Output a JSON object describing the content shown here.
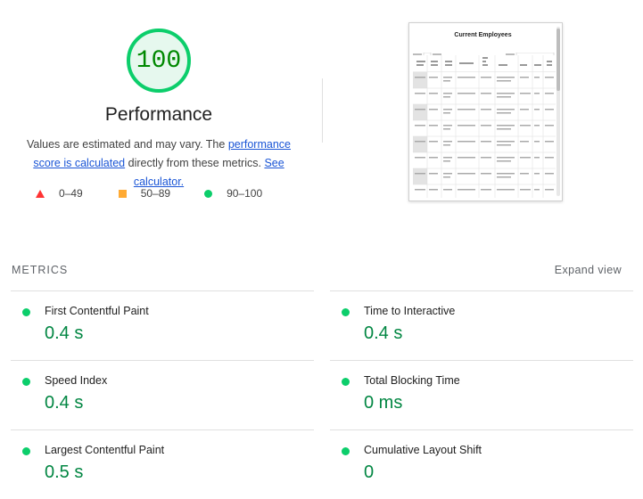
{
  "score": "100",
  "category_title": "Performance",
  "description": {
    "prefix": "Values are estimated and may vary. The ",
    "link1": "performance score is calculated",
    "middle": " directly from these metrics. ",
    "link2": "See calculator."
  },
  "legend": [
    {
      "range": "0–49",
      "color": "#ff3333"
    },
    {
      "range": "50–89",
      "color": "#ffaa33"
    },
    {
      "range": "90–100",
      "color": "#0cce6b"
    }
  ],
  "thumbnail": {
    "title": "Current Employees"
  },
  "metrics_header": "METRICS",
  "expand_view": "Expand view",
  "metrics": [
    {
      "name": "First Contentful Paint",
      "value": "0.4 s"
    },
    {
      "name": "Time to Interactive",
      "value": "0.4 s"
    },
    {
      "name": "Speed Index",
      "value": "0.4 s"
    },
    {
      "name": "Total Blocking Time",
      "value": "0 ms"
    },
    {
      "name": "Largest Contentful Paint",
      "value": "0.5 s"
    },
    {
      "name": "Cumulative Layout Shift",
      "value": "0"
    }
  ],
  "colors": {
    "pass": "#0cce6b",
    "pass_text": "#018642",
    "link": "#1a55d6"
  }
}
